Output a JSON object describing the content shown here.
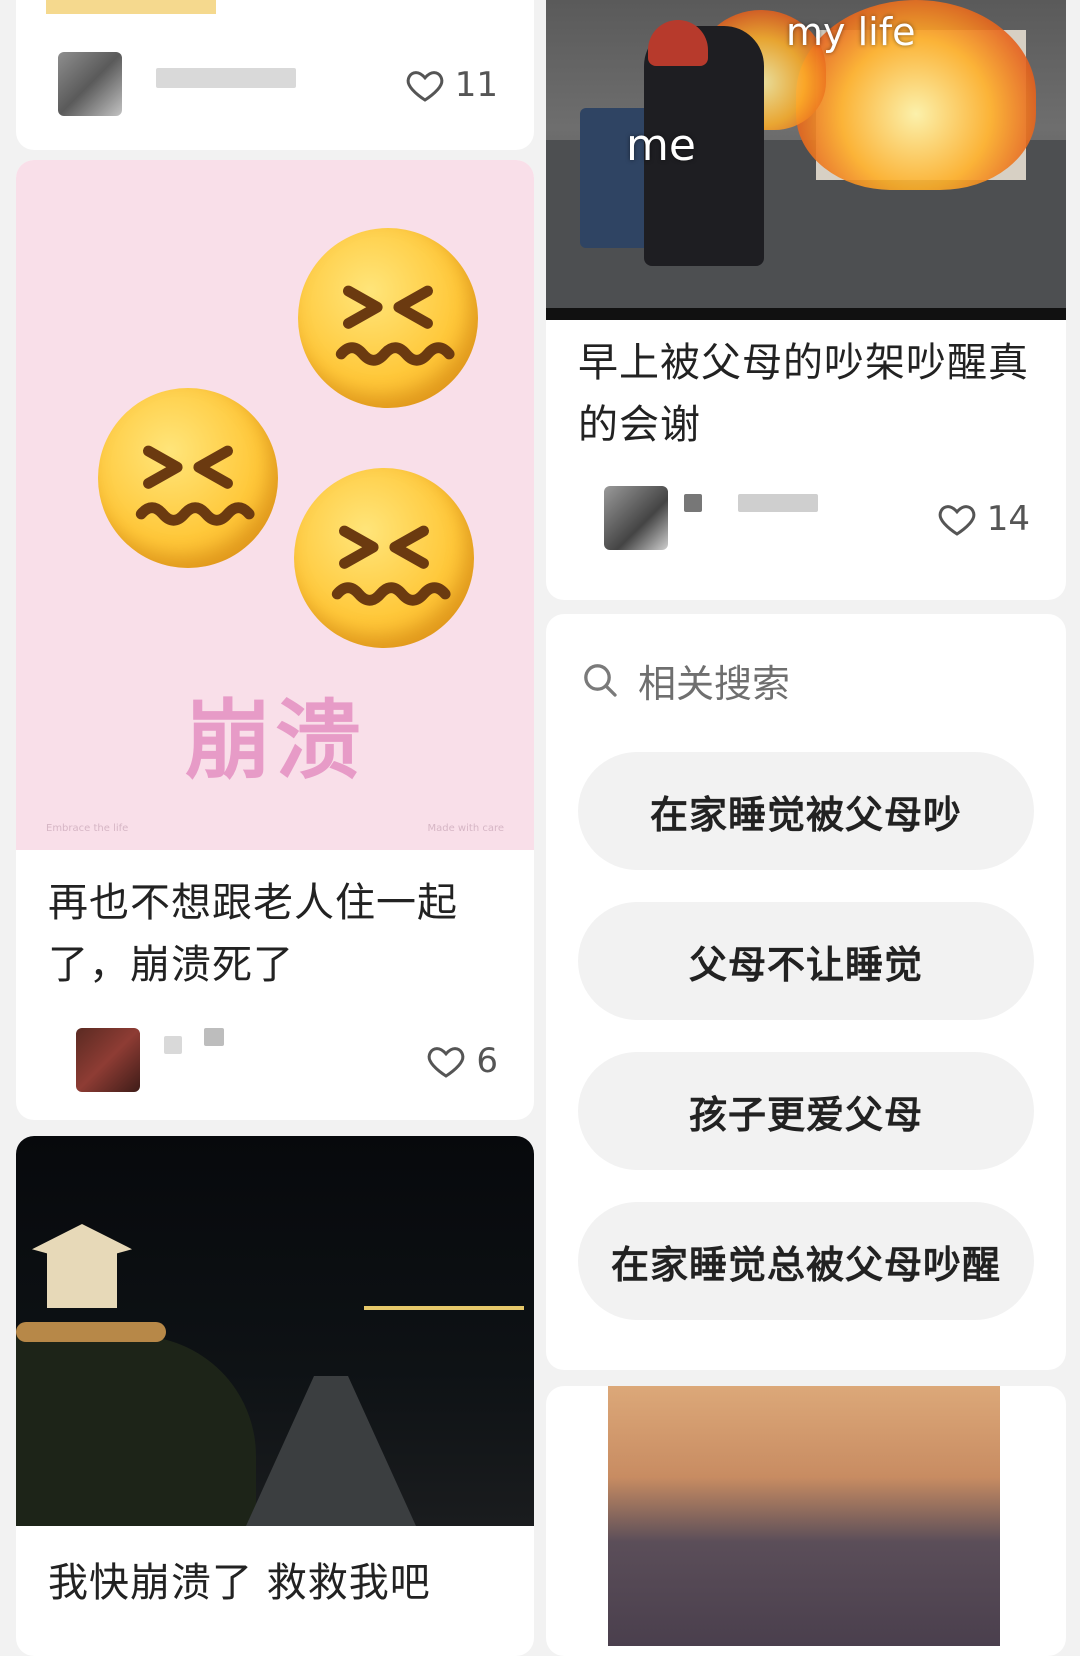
{
  "feed": {
    "left": [
      {
        "likes": "11"
      },
      {
        "image_caption": "崩溃",
        "image_small_left": "Embrace the life",
        "image_small_right": "Made with care",
        "title": "再也不想跟老人住一起了，崩溃死了",
        "likes": "6"
      },
      {
        "title": "我快崩溃了 救救我吧"
      }
    ],
    "right": [
      {
        "image_text_top": "my life",
        "image_text_me": "me",
        "title": "早上被父母的吵架吵醒真的会谢",
        "likes": "14"
      }
    ]
  },
  "related_search": {
    "heading": "相关搜索",
    "items": [
      "在家睡觉被父母吵",
      "父母不让睡觉",
      "孩子更爱父母",
      "在家睡觉总被父母吵醒"
    ]
  },
  "colors": {
    "background": "#f2f2f2",
    "card": "#ffffff",
    "chip": "#f2f2f2",
    "pink": "#f9dfe9",
    "caption_pink": "#e79bc7"
  },
  "icons": [
    "heart-icon",
    "search-icon"
  ]
}
